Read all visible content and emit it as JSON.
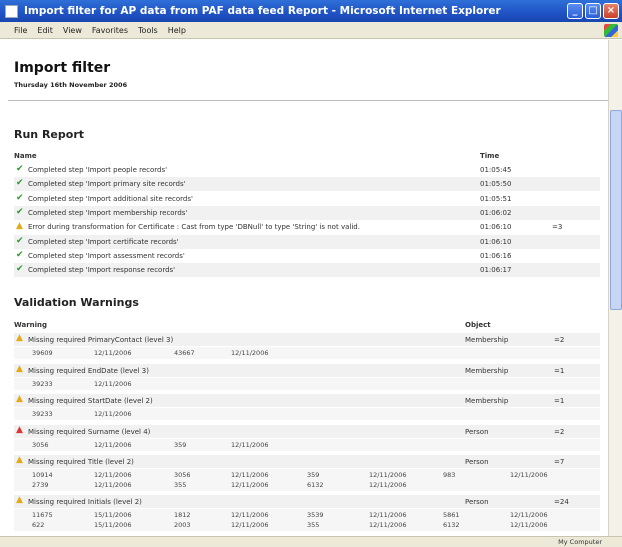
{
  "window": {
    "title": "Import filter for AP data from PAF data feed Report - Microsoft Internet Explorer",
    "menu": [
      "File",
      "Edit",
      "View",
      "Favorites",
      "Tools",
      "Help"
    ],
    "status": "My Computer"
  },
  "page": {
    "title": "Import filter",
    "date": "Thursday 16th November 2006"
  },
  "run_report": {
    "heading": "Run Report",
    "col_name": "Name",
    "col_time": "Time",
    "rows": [
      {
        "status": "ok",
        "name": "Completed step 'Import people records'",
        "time": "01:05:45",
        "extra": ""
      },
      {
        "status": "ok",
        "name": "Completed step 'Import primary site records'",
        "time": "01:05:50",
        "extra": ""
      },
      {
        "status": "ok",
        "name": "Completed step 'Import additional site records'",
        "time": "01:05:51",
        "extra": ""
      },
      {
        "status": "ok",
        "name": "Completed step 'Import membership records'",
        "time": "01:06:02",
        "extra": ""
      },
      {
        "status": "warn",
        "name": "Error during transformation for Certificate : Cast from type 'DBNull' to type 'String' is not valid.",
        "time": "01:06:10",
        "extra": "=3"
      },
      {
        "status": "ok",
        "name": "Completed step 'Import certificate records'",
        "time": "01:06:10",
        "extra": ""
      },
      {
        "status": "ok",
        "name": "Completed step 'Import assessment records'",
        "time": "01:06:16",
        "extra": ""
      },
      {
        "status": "ok",
        "name": "Completed step 'Import response records'",
        "time": "01:06:17",
        "extra": ""
      }
    ]
  },
  "validation": {
    "heading": "Validation Warnings",
    "col_warning": "Warning",
    "col_object": "Object",
    "groups": [
      {
        "status": "warn",
        "text": "Missing required PrimaryContact (level 3)",
        "object": "Membership",
        "count": "=2",
        "data": [
          [
            "39609",
            "12/11/2006",
            "43667",
            "12/11/2006",
            "",
            "",
            "",
            ""
          ]
        ]
      },
      {
        "status": "warn",
        "text": "Missing required EndDate (level 3)",
        "object": "Membership",
        "count": "=1",
        "data": [
          [
            "39233",
            "12/11/2006",
            "",
            "",
            "",
            "",
            "",
            ""
          ]
        ]
      },
      {
        "status": "warn",
        "text": "Missing required StartDate (level 2)",
        "object": "Membership",
        "count": "=1",
        "data": [
          [
            "39233",
            "12/11/2006",
            "",
            "",
            "",
            "",
            "",
            ""
          ]
        ]
      },
      {
        "status": "err",
        "text": "Missing required Surname (level 4)",
        "object": "Person",
        "count": "=2",
        "data": [
          [
            "3056",
            "12/11/2006",
            "359",
            "12/11/2006",
            "",
            "",
            "",
            ""
          ]
        ]
      },
      {
        "status": "warn",
        "text": "Missing required Title (level 2)",
        "object": "Person",
        "count": "=7",
        "data": [
          [
            "10914",
            "12/11/2006",
            "3056",
            "12/11/2006",
            "359",
            "12/11/2006",
            "983",
            "12/11/2006"
          ],
          [
            "2739",
            "12/11/2006",
            "355",
            "12/11/2006",
            "6132",
            "12/11/2006",
            "",
            ""
          ]
        ]
      },
      {
        "status": "warn",
        "text": "Missing required Initials (level 2)",
        "object": "Person",
        "count": "=24",
        "data": [
          [
            "11675",
            "15/11/2006",
            "1812",
            "12/11/2006",
            "3539",
            "12/11/2006",
            "5861",
            "12/11/2006"
          ],
          [
            "622",
            "15/11/2006",
            "2003",
            "12/11/2006",
            "355",
            "12/11/2006",
            "6132",
            "12/11/2006"
          ]
        ]
      }
    ]
  }
}
